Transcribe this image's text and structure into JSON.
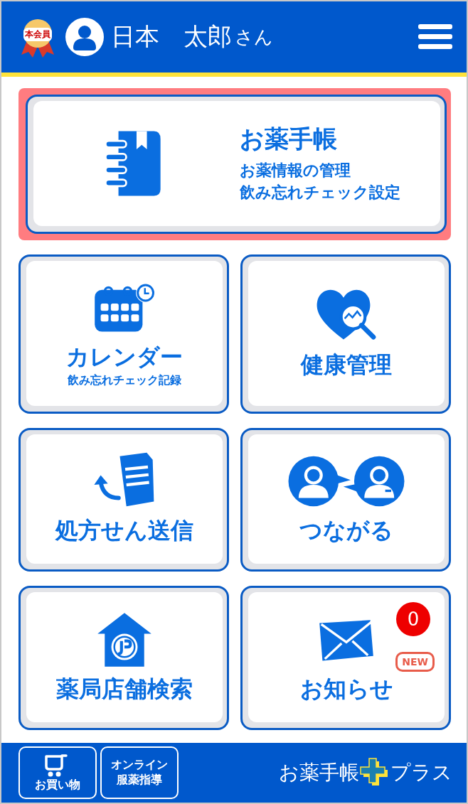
{
  "header": {
    "member_badge": "本会員",
    "user_name": "日本　太郎",
    "honorific": "さん"
  },
  "main_tile": {
    "kind": "notebook",
    "title": "お薬手帳",
    "lines": [
      "お薬情報の管理",
      "飲み忘れチェック設定"
    ],
    "highlighted": true
  },
  "tiles": [
    {
      "kind": "calendar",
      "title": "カレンダー",
      "subtitle": "飲み忘れチェック記録"
    },
    {
      "kind": "health",
      "title": "健康管理"
    },
    {
      "kind": "prescription",
      "title": "処方せん送信"
    },
    {
      "kind": "connect",
      "title": "つながる"
    },
    {
      "kind": "pharmacy",
      "title": "薬局店舗検索"
    },
    {
      "kind": "notice",
      "title": "お知らせ",
      "count": "0",
      "new_label": "NEW"
    }
  ],
  "footer": {
    "buttons": [
      {
        "kind": "shopping",
        "lines": [
          "お買い物"
        ]
      },
      {
        "kind": "online",
        "lines": [
          "オンライン",
          "服薬指導"
        ]
      }
    ],
    "logo_left": "お薬手帳",
    "logo_right": "プラス"
  }
}
